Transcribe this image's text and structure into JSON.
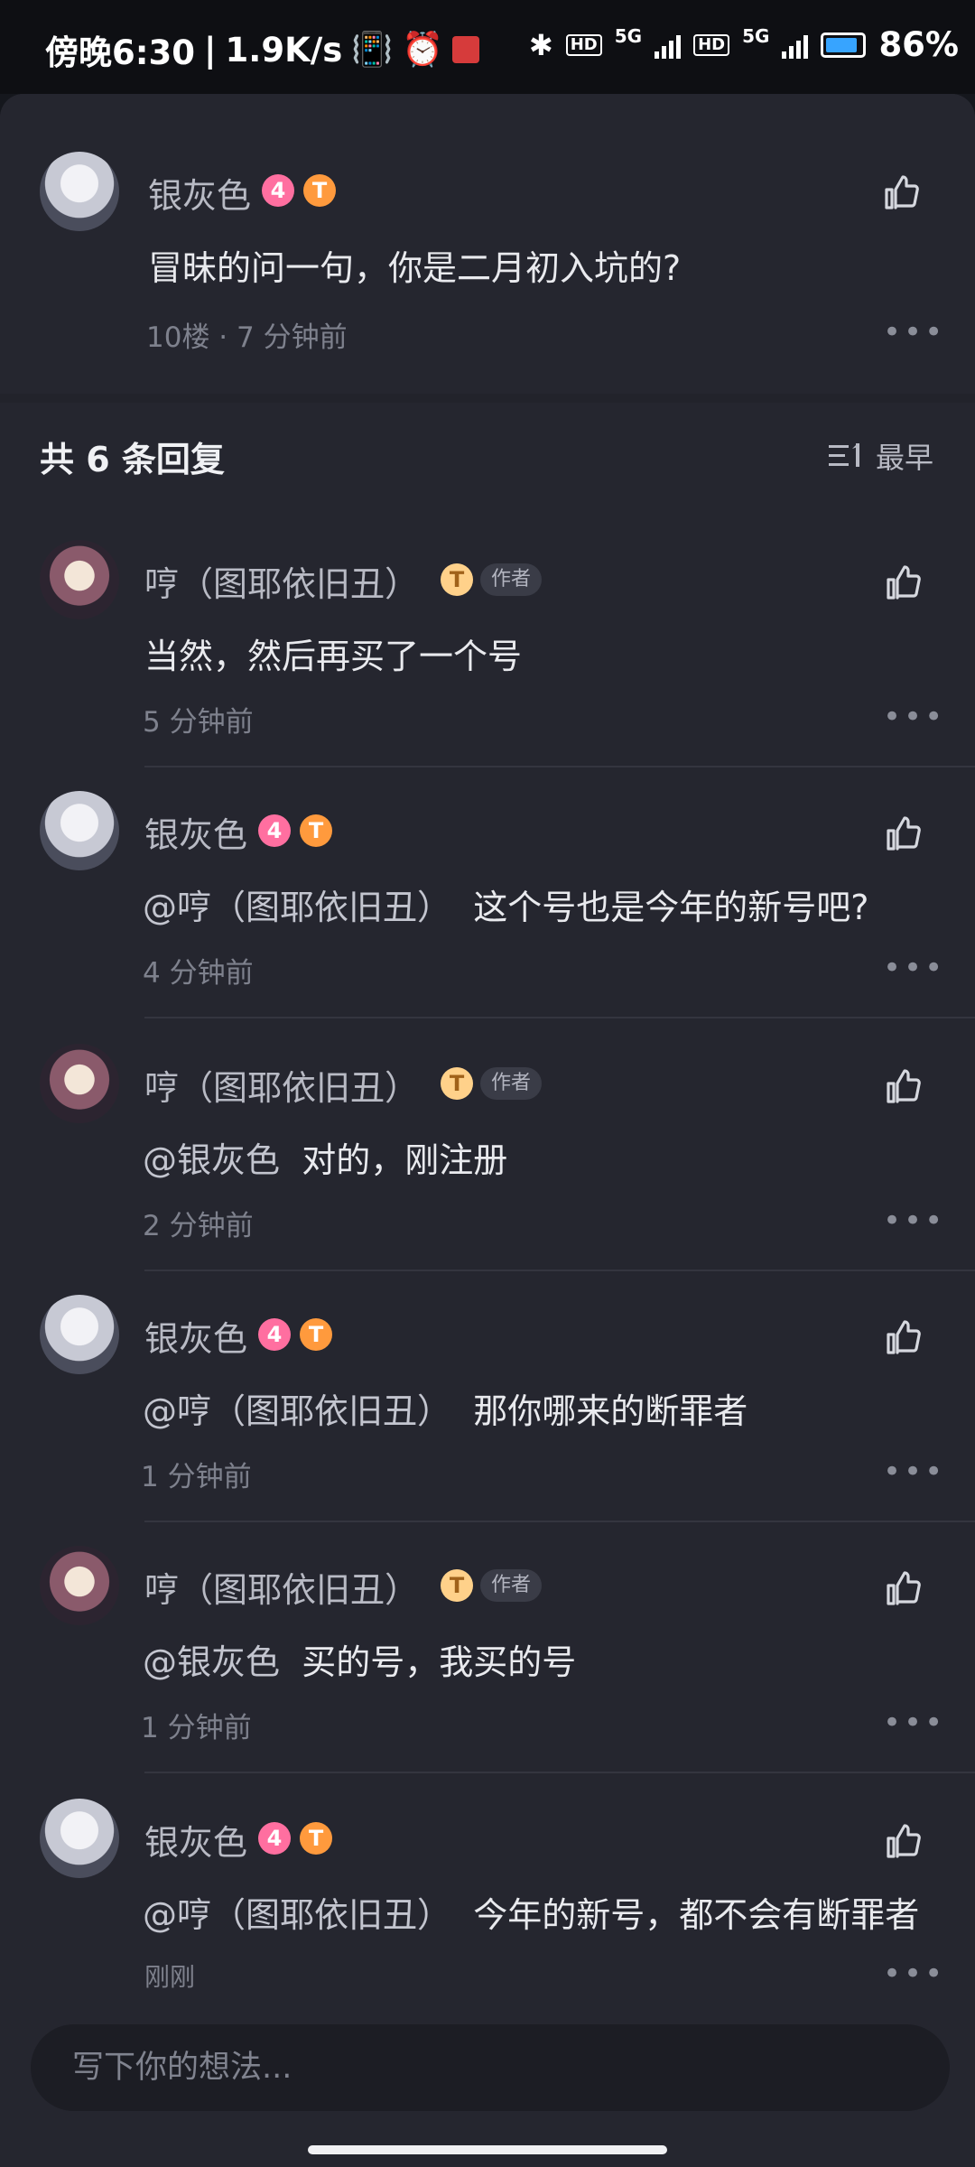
{
  "status_bar": {
    "time": "傍晚6:30",
    "speed": "1.9K/s",
    "network1": "5G",
    "network2": "5G",
    "hd_label": "HD",
    "battery": "86%"
  },
  "main_comment": {
    "user": "银灰色",
    "level_badge": "4",
    "title_badge": "T",
    "text": "冒昧的问一句，你是二月初入坑的?",
    "meta": "10楼 · 7 分钟前"
  },
  "replies_header": {
    "title": "共 6 条回复",
    "sort_label": "最早"
  },
  "replies": [
    {
      "user": "哼（图耶依旧丑）",
      "badge": "T",
      "tag": "作者",
      "mention": "",
      "text": "当然，然后再买了一个号",
      "time": "5 分钟前"
    },
    {
      "user": "银灰色",
      "level": "4",
      "badge": "T",
      "mention": "@哼（图耶依旧丑）",
      "text": "这个号也是今年的新号吧?",
      "time": "4 分钟前"
    },
    {
      "user": "哼（图耶依旧丑）",
      "badge": "T",
      "tag": "作者",
      "mention": "@银灰色",
      "text": "对的，刚注册",
      "time": "2 分钟前"
    },
    {
      "user": "银灰色",
      "level": "4",
      "badge": "T",
      "mention": "@哼（图耶依旧丑）",
      "text": "那你哪来的断罪者",
      "time": "1 分钟前"
    },
    {
      "user": "哼（图耶依旧丑）",
      "badge": "T",
      "tag": "作者",
      "mention": "@银灰色",
      "text": "买的号，我买的号",
      "time": "1 分钟前"
    },
    {
      "user": "银灰色",
      "level": "4",
      "badge": "T",
      "mention": "@哼（图耶依旧丑）",
      "text": "今年的新号，都不会有断罪者",
      "time": "刚刚"
    }
  ],
  "input": {
    "placeholder": "写下你的想法..."
  },
  "colors": {
    "background": "#25262f",
    "level_badge": "#ff6fa0",
    "title_badge": "#ff9a3d"
  }
}
